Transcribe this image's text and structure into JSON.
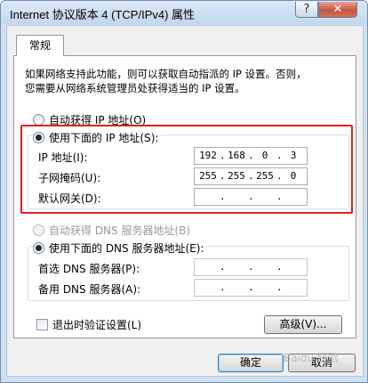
{
  "window": {
    "title": "Internet 协议版本 4 (TCP/IPv4) 属性",
    "help_label": "?",
    "close_label": "✕"
  },
  "tab": {
    "label": "常规"
  },
  "description": [
    "如果网络支持此功能，则可以获取自动指派的 IP 设置。否则，",
    "您需要从网络系统管理员处获得适当的 IP 设置。"
  ],
  "ip_section": {
    "auto_label": "自动获得 IP 地址(O)",
    "manual_label": "使用下面的 IP 地址(S):",
    "fields": [
      {
        "label": "IP 地址(I):",
        "octets": [
          "192",
          "168",
          "0",
          "3"
        ]
      },
      {
        "label": "子网掩码(U):",
        "octets": [
          "255",
          "255",
          "255",
          "0"
        ]
      },
      {
        "label": "默认网关(D):",
        "octets": [
          "",
          "",
          "",
          ""
        ]
      }
    ]
  },
  "dns_section": {
    "auto_label": "自动获得 DNS 服务器地址(B)",
    "manual_label": "使用下面的 DNS 服务器地址(E):",
    "fields": [
      {
        "label": "首选 DNS 服务器(P):",
        "octets": [
          "",
          "",
          "",
          ""
        ]
      },
      {
        "label": "备用 DNS 服务器(A):",
        "octets": [
          "",
          "",
          "",
          ""
        ]
      }
    ]
  },
  "validate_label": "退出时验证设置(L)",
  "advanced_label": "高级(V)...",
  "ok_label": "确定",
  "cancel_label": "取消",
  "watermark": "Baidu 经验",
  "colors": {
    "highlight": "#e12020",
    "default_button_border": "#3c7fb1"
  }
}
